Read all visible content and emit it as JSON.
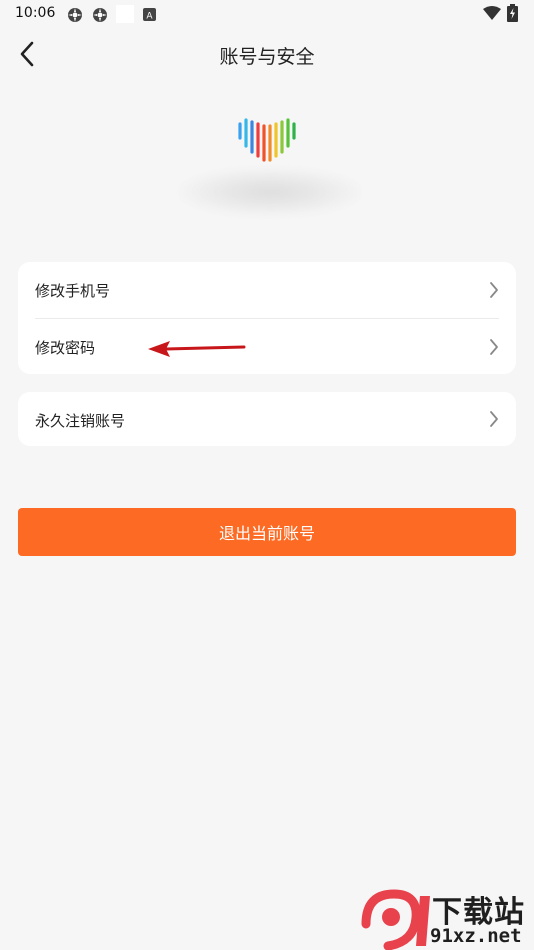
{
  "status_bar": {
    "time": "10:06",
    "icons": [
      "gear-icon",
      "gear-icon",
      "white-square-icon",
      "a-badge-icon",
      "wifi-icon",
      "battery-charging-icon"
    ],
    "badge_letter": "A"
  },
  "header": {
    "title": "账号与安全",
    "back_icon": "chevron-left-icon"
  },
  "profile": {
    "logo_icon": "rainbow-heart-logo",
    "logo_colors": [
      "#3aa0f0",
      "#35b8e8",
      "#f03c3c",
      "#f08a2a",
      "#f0c52a",
      "#55c23a",
      "#2fb24a"
    ]
  },
  "account_card": {
    "items": [
      {
        "label": "修改手机号"
      },
      {
        "label": "修改密码"
      }
    ]
  },
  "danger_card": {
    "items": [
      {
        "label": "永久注销账号"
      }
    ]
  },
  "logout": {
    "label": "退出当前账号",
    "color": "#fd6a23"
  },
  "watermark": {
    "brand": "下载站",
    "url": "91xz.net",
    "accent": "#e8424c"
  }
}
